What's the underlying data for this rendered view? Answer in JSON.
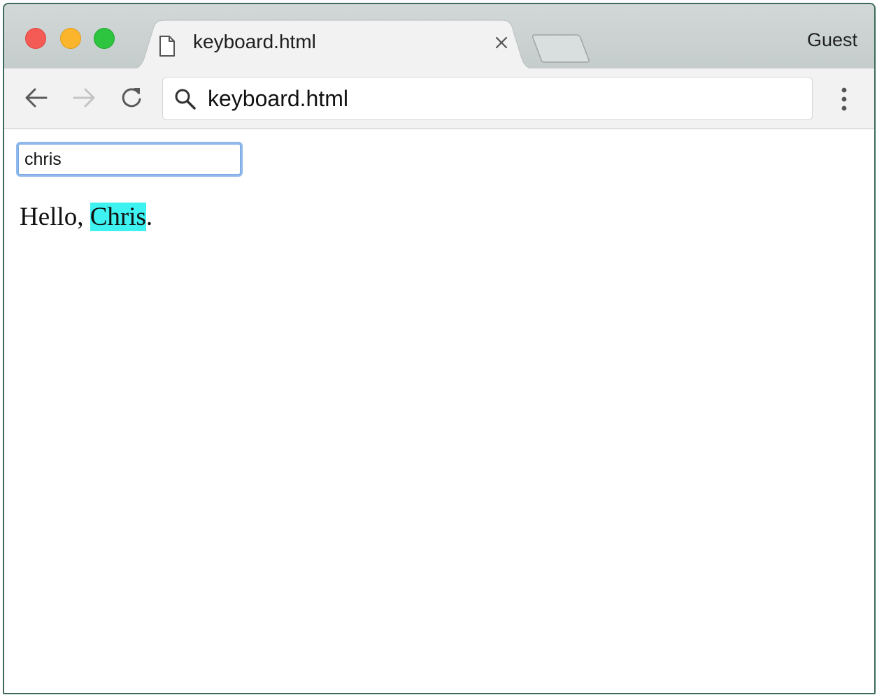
{
  "window": {
    "tab": {
      "title": "keyboard.html",
      "file_icon": "page-icon",
      "close_icon": "close-icon"
    },
    "profile_label": "Guest",
    "traffic_lights": {
      "close": "#f45b55",
      "minimize": "#fbb52c",
      "zoom": "#2dc43f"
    }
  },
  "toolbar": {
    "back_icon": "arrow-left-icon",
    "forward_icon": "arrow-right-icon",
    "reload_icon": "reload-icon",
    "address": {
      "search_icon": "search-icon",
      "url": "keyboard.html"
    },
    "menu_icon": "kebab-menu-icon"
  },
  "page": {
    "name_input_value": "chris",
    "greeting": {
      "prefix": "Hello, ",
      "name": "Chris",
      "suffix": "."
    },
    "highlight_color": "#3df2f0",
    "focus_ring_color": "#8fb8ec"
  }
}
